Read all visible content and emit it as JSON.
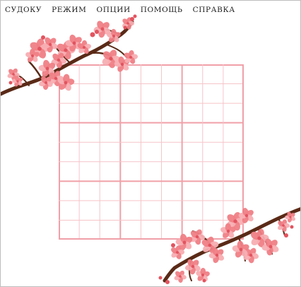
{
  "menu": {
    "items": [
      {
        "id": "sudoku",
        "label": "СУДОКУ"
      },
      {
        "id": "mode",
        "label": "РЕЖИМ"
      },
      {
        "id": "options",
        "label": "ОПЦИИ"
      },
      {
        "id": "help",
        "label": "ПОМОЩЬ"
      },
      {
        "id": "about",
        "label": "СПРАВКА"
      }
    ]
  },
  "board": {
    "size": 9,
    "cells": [
      [
        "",
        "",
        "",
        "",
        "",
        "",
        "",
        "",
        ""
      ],
      [
        "",
        "",
        "",
        "",
        "",
        "",
        "",
        "",
        ""
      ],
      [
        "",
        "",
        "",
        "",
        "",
        "",
        "",
        "",
        ""
      ],
      [
        "",
        "",
        "",
        "",
        "",
        "",
        "",
        "",
        ""
      ],
      [
        "",
        "",
        "",
        "",
        "",
        "",
        "",
        "",
        ""
      ],
      [
        "",
        "",
        "",
        "",
        "",
        "",
        "",
        "",
        ""
      ],
      [
        "",
        "",
        "",
        "",
        "",
        "",
        "",
        "",
        ""
      ],
      [
        "",
        "",
        "",
        "",
        "",
        "",
        "",
        "",
        ""
      ],
      [
        "",
        "",
        "",
        "",
        "",
        "",
        "",
        "",
        ""
      ]
    ]
  },
  "colors": {
    "grid_thin": "#f6c4c8",
    "grid_thick": "#f0a0a8",
    "blossom_light": "#f7aeb2",
    "blossom_mid": "#ef7f86",
    "blossom_dark": "#e2545f",
    "branch": "#5a2a17",
    "menu_text": "#1d1d1d"
  },
  "decorations": [
    "cherry-blossom-branch-top-left",
    "cherry-blossom-branch-bottom-right"
  ]
}
